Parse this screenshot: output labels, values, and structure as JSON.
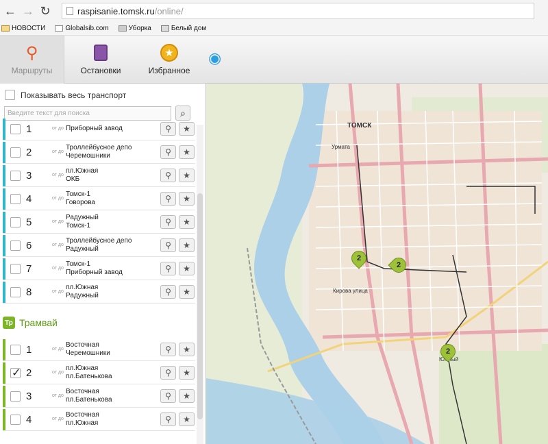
{
  "browser": {
    "url_host": "raspisanie.tomsk.ru",
    "url_path": "/online/",
    "bookmarks": [
      "НОВОСТИ",
      "Globalsib.com",
      "Уборка",
      "Белый дом"
    ]
  },
  "tabs": [
    {
      "label": "Маршруты",
      "icon": "route-pin-icon",
      "active": true
    },
    {
      "label": "Остановки",
      "icon": "bus-stop-icon",
      "active": false
    },
    {
      "label": "Избранное",
      "icon": "star-icon",
      "active": false
    }
  ],
  "sidebar": {
    "show_all_label": "Показывать весь транспорт",
    "search_placeholder": "Введите текст для поиска",
    "from_to": "от до",
    "trolley_color": "#2fb6c8",
    "tram_color": "#7cb526",
    "trolleybus_routes": [
      {
        "num": "1",
        "from": "",
        "to": "Приборный завод",
        "checked": false
      },
      {
        "num": "2",
        "from": "Троллейбусное депо",
        "to": "Черемошники",
        "checked": false
      },
      {
        "num": "3",
        "from": "пл.Южная",
        "to": "ОКБ",
        "checked": false
      },
      {
        "num": "4",
        "from": "Томск-1",
        "to": "Говорова",
        "checked": false
      },
      {
        "num": "5",
        "from": "Радужный",
        "to": "Томск-1",
        "checked": false
      },
      {
        "num": "6",
        "from": "Троллейбусное депо",
        "to": "Радужный",
        "checked": false
      },
      {
        "num": "7",
        "from": "Томск-1",
        "to": "Приборный завод",
        "checked": false
      },
      {
        "num": "8",
        "from": "пл.Южная",
        "to": "Радужный",
        "checked": false
      }
    ],
    "tram_heading": "Трамвай",
    "tram_icon_text": "Тр",
    "tram_routes": [
      {
        "num": "1",
        "from": "Восточная",
        "to": "Черемошники",
        "checked": false
      },
      {
        "num": "2",
        "from": "пл.Южная",
        "to": "пл.Батенькова",
        "checked": true
      },
      {
        "num": "3",
        "from": "Восточная",
        "to": "пл.Батенькова",
        "checked": false
      },
      {
        "num": "4",
        "from": "Восточная",
        "to": "пл.Южная",
        "checked": false
      }
    ]
  },
  "map": {
    "labels": [
      "ТОМСК",
      "Урмата",
      "Кирова улица",
      "Южный"
    ],
    "vehicle_markers": [
      {
        "route": "2"
      },
      {
        "route": "2"
      },
      {
        "route": "2"
      }
    ]
  }
}
